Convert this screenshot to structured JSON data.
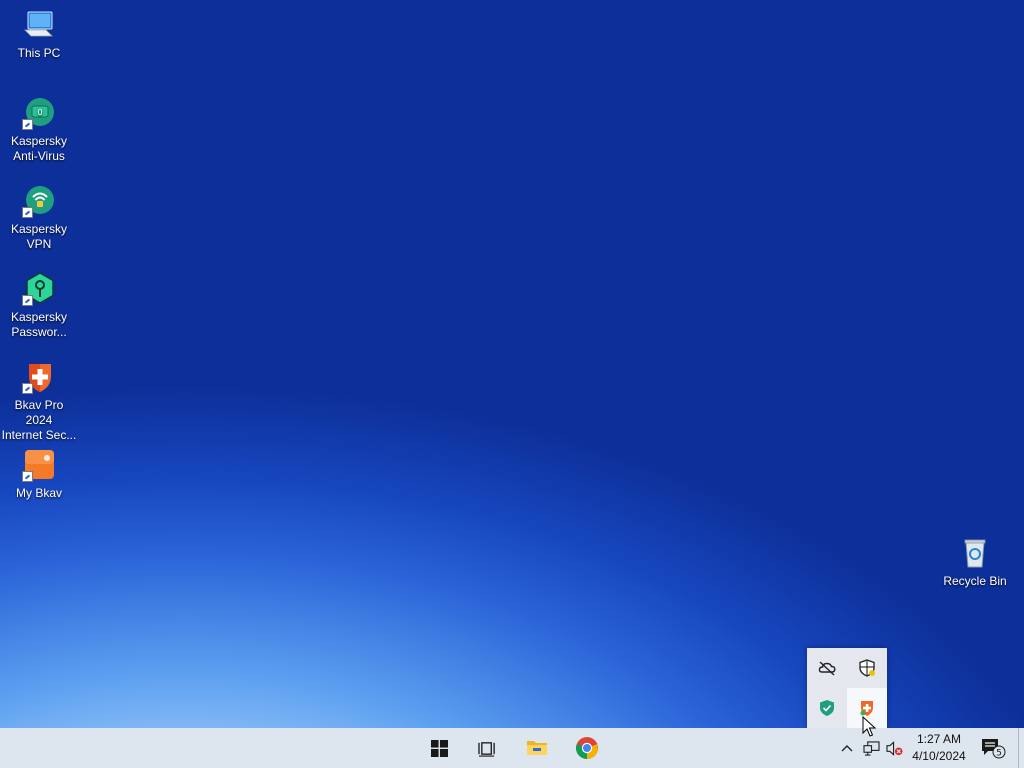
{
  "desktop": {
    "icons": [
      {
        "label": "This PC",
        "icon": "this-pc-icon"
      },
      {
        "label": "Kaspersky\nAnti-Virus",
        "icon": "kaspersky-antivirus-icon"
      },
      {
        "label": "Kaspersky\nVPN",
        "icon": "kaspersky-vpn-icon"
      },
      {
        "label": "Kaspersky\nPasswor...",
        "icon": "kaspersky-password-icon"
      },
      {
        "label": "Bkav Pro 2024\nInternet Sec...",
        "icon": "bkav-pro-icon"
      },
      {
        "label": "My Bkav",
        "icon": "my-bkav-icon"
      },
      {
        "label": "Recycle Bin",
        "icon": "recycle-bin-icon"
      }
    ]
  },
  "tray_popup": {
    "items": [
      "onedrive-offline-icon",
      "windows-security-icon",
      "kaspersky-tray-icon",
      "bkav-tray-icon"
    ]
  },
  "taskbar": {
    "pinned": [
      "start-icon",
      "task-view-icon",
      "file-explorer-icon",
      "chrome-icon"
    ],
    "tray": [
      "show-hidden-icons-chevron",
      "network-icon",
      "volume-muted-icon"
    ],
    "time": "1:27 AM",
    "date": "4/10/2024",
    "notifications_count": "5"
  },
  "colors": {
    "taskbar_bg": "#dde5ef",
    "kaspersky_green": "#1f9f80",
    "bkav_orange": "#ef6a2a"
  }
}
